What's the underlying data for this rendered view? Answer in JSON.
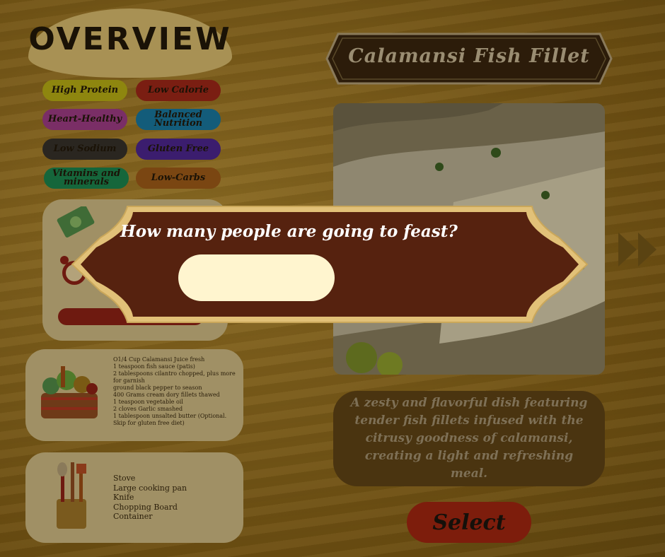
{
  "overview": {
    "title": "OVERVIEW",
    "tags": [
      {
        "label": "High Protein",
        "color": "#8e860f"
      },
      {
        "label": "Low Calorie",
        "color": "#7a1e12"
      },
      {
        "label": "Heart-Healthy",
        "color": "#7a2e66"
      },
      {
        "label": "Balanced Nutrition",
        "color": "#135c7a"
      },
      {
        "label": "Low Sodium",
        "color": "#2a2620"
      },
      {
        "label": "Gluten Free",
        "color": "#3b1d6e"
      },
      {
        "label": "Vitamins and minerals",
        "color": "#15663b"
      },
      {
        "label": "Low-Carbs",
        "color": "#7a4612"
      }
    ]
  },
  "ingredients": [
    "O1/4 Cup Calamansi Juice fresh",
    "1 teaspoon fish sauce (patis)",
    "2 tablespoons cilantro chopped, plus more",
    "for garnish",
    "ground black pepper to season",
    "400 Grams cream dory fillets thawed",
    "1 teaspoon vegetable oil",
    "2 cloves Garlic smashed",
    "1 tablespoon unsalted butter (Optional.",
    "Skip for gluten free diet)"
  ],
  "tools": [
    "Stove",
    "Large cooking pan",
    "Knife",
    "Chopping Board",
    "Container"
  ],
  "recipe": {
    "title": "Calamansi Fish Fillet",
    "description": "A zesty and flavorful dish featuring tender fish fillets infused with the citrusy goodness of calamansi, creating a light and refreshing meal.",
    "select_label": "Select"
  },
  "modal": {
    "question": "How many people are going to feast?",
    "input_value": "",
    "input_placeholder": ""
  },
  "icons": {
    "money": "money-icon",
    "clock": "alarm-clock-icon",
    "basket": "vegetable-basket-icon",
    "utensils": "utensil-holder-icon",
    "next": "next-arrow-icon"
  }
}
